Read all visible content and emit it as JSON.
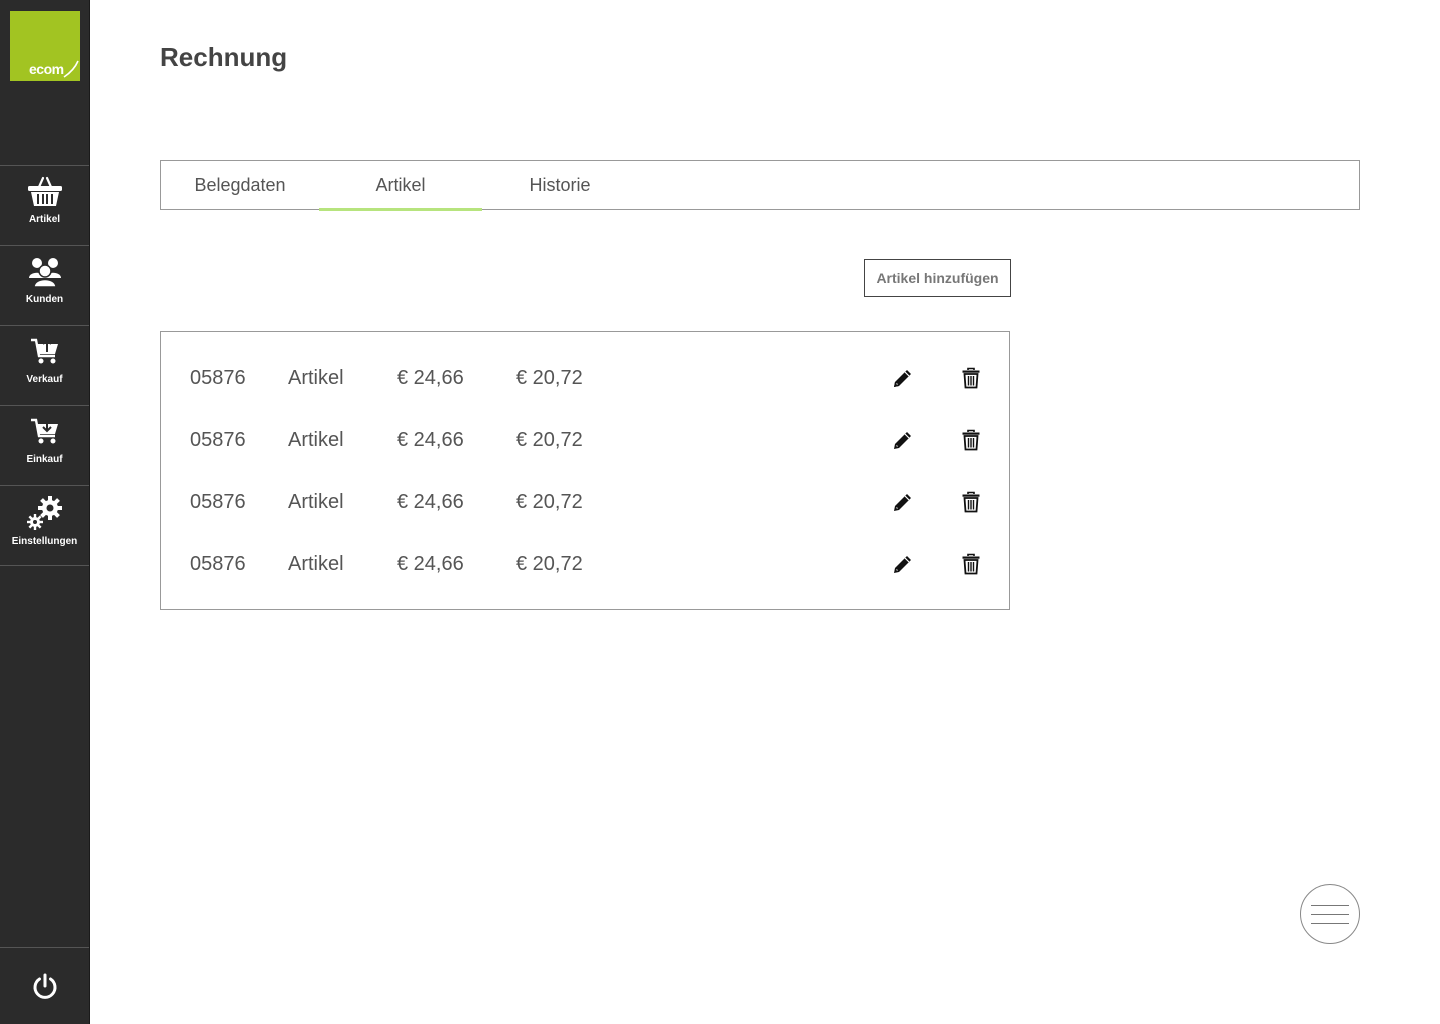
{
  "logo": {
    "text": "ecom",
    "color": "#a2c422"
  },
  "sidebar": {
    "items": [
      {
        "label": "Artikel",
        "icon": "basket-icon"
      },
      {
        "label": "Kunden",
        "icon": "users-icon"
      },
      {
        "label": "Verkauf",
        "icon": "cart-upload-icon"
      },
      {
        "label": "Einkauf",
        "icon": "cart-download-icon"
      },
      {
        "label": "Einstellungen",
        "icon": "gears-icon"
      }
    ],
    "power_icon": "power-icon"
  },
  "page": {
    "title": "Rechnung"
  },
  "tabs": [
    {
      "label": "Belegdaten",
      "active": false
    },
    {
      "label": "Artikel",
      "active": true
    },
    {
      "label": "Historie",
      "active": false
    }
  ],
  "accent_color": "#b7e47e",
  "actions": {
    "add_label": "Artikel hinzufügen"
  },
  "items": [
    {
      "number": "05876",
      "name": "Artikel",
      "price1": "€ 24,66",
      "price2": "€ 20,72"
    },
    {
      "number": "05876",
      "name": "Artikel",
      "price1": "€ 24,66",
      "price2": "€ 20,72"
    },
    {
      "number": "05876",
      "name": "Artikel",
      "price1": "€ 24,66",
      "price2": "€ 20,72"
    },
    {
      "number": "05876",
      "name": "Artikel",
      "price1": "€ 24,66",
      "price2": "€ 20,72"
    }
  ],
  "fab_icon": "menu-icon"
}
